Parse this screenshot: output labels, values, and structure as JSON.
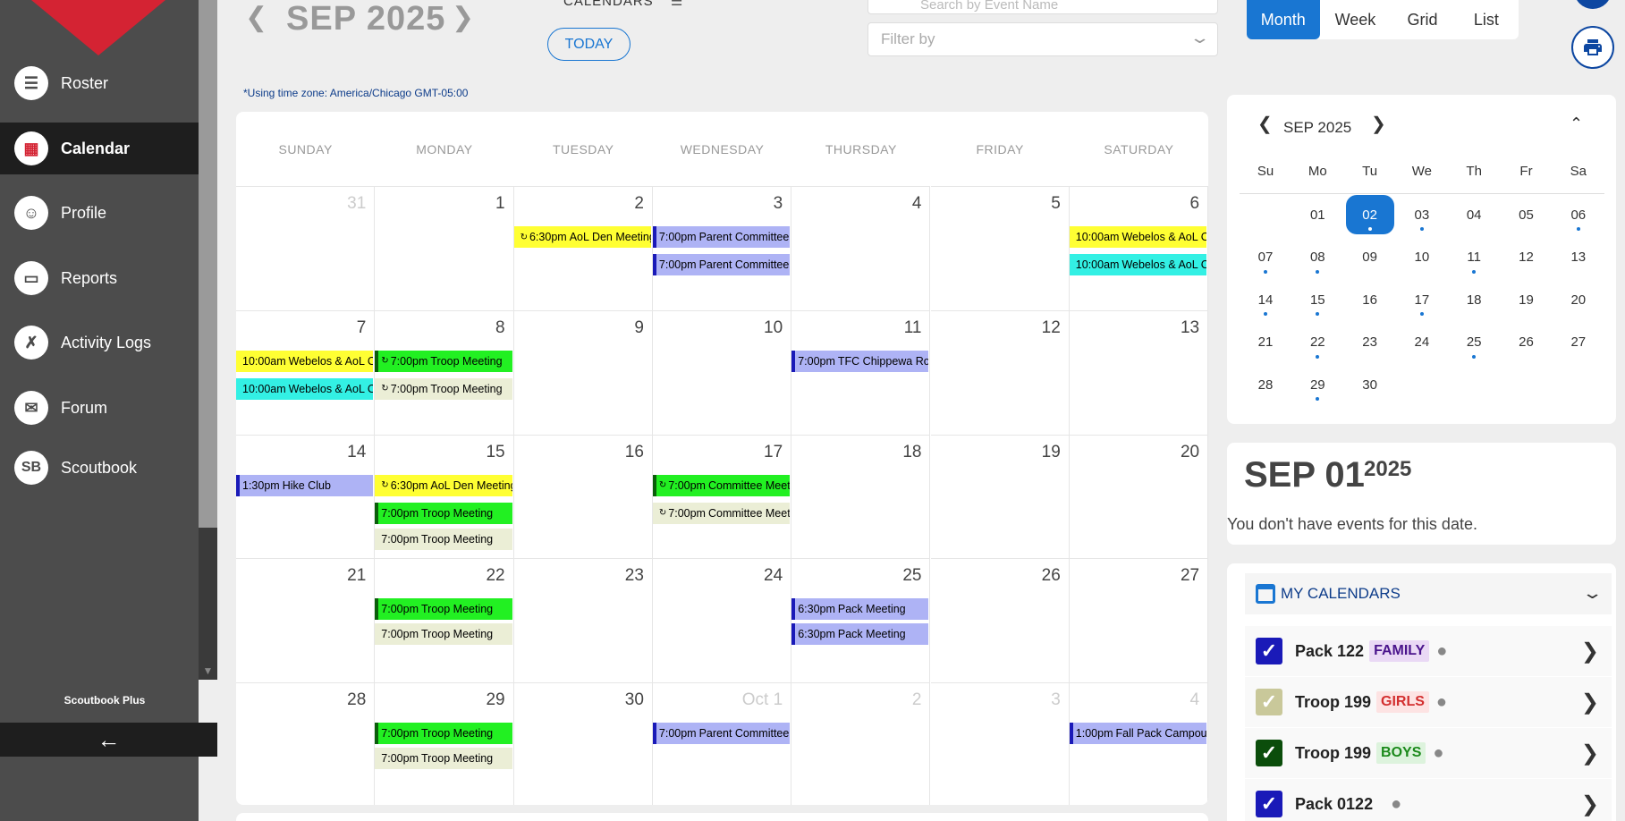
{
  "sidebar": {
    "items": [
      {
        "label": "Roster",
        "icon": "list-icon",
        "glyph": "☰"
      },
      {
        "label": "Calendar",
        "icon": "calendar-icon",
        "glyph": "▦"
      },
      {
        "label": "Profile",
        "icon": "face-icon",
        "glyph": "☺"
      },
      {
        "label": "Reports",
        "icon": "clipboard-icon",
        "glyph": "▭"
      },
      {
        "label": "Activity Logs",
        "icon": "activity-icon",
        "glyph": "✗"
      },
      {
        "label": "Forum",
        "icon": "forum-icon",
        "glyph": "✉"
      },
      {
        "label": "Scoutbook",
        "icon": "scoutbook-icon",
        "glyph": "SB"
      }
    ],
    "active_index": 1,
    "plus_label": "Scoutbook Plus",
    "collapse_glyph": "←"
  },
  "header": {
    "title": "SEP 2025",
    "calendars_label": "CALENDARS",
    "today_label": "TODAY",
    "search_placeholder": "Search by Event Name",
    "filter_placeholder": "Filter by",
    "views": [
      "Month",
      "Week",
      "Grid",
      "List"
    ],
    "selected_view": "Month",
    "timezone_note": "*Using time zone: America/Chicago GMT-05:00"
  },
  "calendar": {
    "weekdays": [
      "SUNDAY",
      "MONDAY",
      "TUESDAY",
      "WEDNESDAY",
      "THURSDAY",
      "FRIDAY",
      "SATURDAY"
    ],
    "weeks": [
      [
        {
          "day": "31",
          "other": true
        },
        {
          "day": "1"
        },
        {
          "day": "2"
        },
        {
          "day": "3"
        },
        {
          "day": "4"
        },
        {
          "day": "5"
        },
        {
          "day": "6"
        }
      ],
      [
        {
          "day": "7"
        },
        {
          "day": "8"
        },
        {
          "day": "9"
        },
        {
          "day": "10"
        },
        {
          "day": "11"
        },
        {
          "day": "12"
        },
        {
          "day": "13"
        }
      ],
      [
        {
          "day": "14"
        },
        {
          "day": "15"
        },
        {
          "day": "16"
        },
        {
          "day": "17"
        },
        {
          "day": "18"
        },
        {
          "day": "19"
        },
        {
          "day": "20"
        }
      ],
      [
        {
          "day": "21"
        },
        {
          "day": "22"
        },
        {
          "day": "23"
        },
        {
          "day": "24"
        },
        {
          "day": "25"
        },
        {
          "day": "26"
        },
        {
          "day": "27"
        }
      ],
      [
        {
          "day": "28"
        },
        {
          "day": "29"
        },
        {
          "day": "30"
        },
        {
          "day": "Oct 1",
          "other": true
        },
        {
          "day": "2",
          "other": true
        },
        {
          "day": "3",
          "other": true
        },
        {
          "day": "4",
          "other": true
        }
      ]
    ],
    "events": [
      {
        "week": 0,
        "col": 2,
        "slot": 0,
        "time": "6:30pm",
        "title": "AoL Den Meeting",
        "recurring": true,
        "bg": "#ffff33",
        "bar": "#ffff33"
      },
      {
        "week": 0,
        "col": 3,
        "slot": 0,
        "time": "7:00pm",
        "title": "Parent Committee",
        "recurring": false,
        "bg": "#aeb3f5",
        "bar": "#1a1ab8"
      },
      {
        "week": 0,
        "col": 3,
        "slot": 1,
        "time": "7:00pm",
        "title": "Parent Committee",
        "recurring": false,
        "bg": "#aeb3f5",
        "bar": "#1a1ab8"
      },
      {
        "week": 0,
        "col": 6,
        "slot": 0,
        "time": "10:00am",
        "title": "Webelos & AoL Camp",
        "recurring": false,
        "bg": "#ffff33",
        "bar": "#ffff33"
      },
      {
        "week": 0,
        "col": 6,
        "slot": 1,
        "time": "10:00am",
        "title": "Webelos & AoL Camp",
        "recurring": false,
        "bg": "#33f0e4",
        "bar": "#33f0e4"
      },
      {
        "week": 1,
        "col": 0,
        "slot": 0,
        "time": "10:00am",
        "title": "Webelos & AoL Camp",
        "recurring": false,
        "bg": "#ffff33",
        "bar": "#ffff33"
      },
      {
        "week": 1,
        "col": 0,
        "slot": 1,
        "time": "10:00am",
        "title": "Webelos & AoL Camp",
        "recurring": false,
        "bg": "#33f0e4",
        "bar": "#33f0e4"
      },
      {
        "week": 1,
        "col": 1,
        "slot": 0,
        "time": "7:00pm",
        "title": "Troop Meeting",
        "recurring": true,
        "bg": "#22f022",
        "bar": "#0b5e0b"
      },
      {
        "week": 1,
        "col": 1,
        "slot": 1,
        "time": "7:00pm",
        "title": "Troop Meeting",
        "recurring": true,
        "bg": "#ebeed6",
        "bar": "#ebeed6"
      },
      {
        "week": 1,
        "col": 4,
        "slot": 0,
        "time": "7:00pm",
        "title": "TFC Chippewa Round",
        "recurring": false,
        "bg": "#aeb3f5",
        "bar": "#1a1ab8"
      },
      {
        "week": 2,
        "col": 0,
        "slot": 0,
        "time": "1:30pm",
        "title": "Hike Club",
        "recurring": false,
        "bg": "#aeb3f5",
        "bar": "#1a1ab8"
      },
      {
        "week": 2,
        "col": 1,
        "slot": 0,
        "time": "6:30pm",
        "title": "AoL Den Meeting",
        "recurring": true,
        "bg": "#ffff33",
        "bar": "#ffff33"
      },
      {
        "week": 2,
        "col": 1,
        "slot": 1,
        "time": "7:00pm",
        "title": "Troop Meeting",
        "recurring": false,
        "bg": "#22f022",
        "bar": "#0b5e0b"
      },
      {
        "week": 2,
        "col": 1,
        "slot": 2,
        "time": "7:00pm",
        "title": "Troop Meeting",
        "recurring": false,
        "bg": "#ebeed6",
        "bar": "#ebeed6"
      },
      {
        "week": 2,
        "col": 3,
        "slot": 0,
        "time": "7:00pm",
        "title": "Committee Meeting",
        "recurring": true,
        "bg": "#22f022",
        "bar": "#0b5e0b"
      },
      {
        "week": 2,
        "col": 3,
        "slot": 1,
        "time": "7:00pm",
        "title": "Committee Meeting",
        "recurring": true,
        "bg": "#ebeed6",
        "bar": "#ebeed6"
      },
      {
        "week": 3,
        "col": 1,
        "slot": 0,
        "time": "7:00pm",
        "title": "Troop Meeting",
        "recurring": false,
        "bg": "#22f022",
        "bar": "#0b5e0b"
      },
      {
        "week": 3,
        "col": 1,
        "slot": 1,
        "time": "7:00pm",
        "title": "Troop Meeting",
        "recurring": false,
        "bg": "#ebeed6",
        "bar": "#ebeed6"
      },
      {
        "week": 3,
        "col": 4,
        "slot": 0,
        "time": "6:30pm",
        "title": "Pack Meeting",
        "recurring": false,
        "bg": "#aeb3f5",
        "bar": "#1a1ab8"
      },
      {
        "week": 3,
        "col": 4,
        "slot": 1,
        "time": "6:30pm",
        "title": "Pack Meeting",
        "recurring": false,
        "bg": "#aeb3f5",
        "bar": "#1a1ab8"
      },
      {
        "week": 4,
        "col": 1,
        "slot": 0,
        "time": "7:00pm",
        "title": "Troop Meeting",
        "recurring": false,
        "bg": "#22f022",
        "bar": "#0b5e0b"
      },
      {
        "week": 4,
        "col": 1,
        "slot": 1,
        "time": "7:00pm",
        "title": "Troop Meeting",
        "recurring": false,
        "bg": "#ebeed6",
        "bar": "#ebeed6"
      },
      {
        "week": 4,
        "col": 3,
        "slot": 0,
        "time": "7:00pm",
        "title": "Parent Committee",
        "recurring": false,
        "bg": "#aeb3f5",
        "bar": "#1a1ab8"
      },
      {
        "week": 4,
        "col": 6,
        "slot": 0,
        "time": "1:00pm",
        "title": "Fall Pack Campout",
        "recurring": false,
        "bg": "#aeb3f5",
        "bar": "#1a1ab8"
      }
    ]
  },
  "mini_calendar": {
    "title": "SEP 2025",
    "weekdays": [
      "Su",
      "Mo",
      "Tu",
      "We",
      "Th",
      "Fr",
      "Sa"
    ],
    "lead_blanks": 1,
    "days": [
      {
        "d": "01",
        "dot": false
      },
      {
        "d": "02",
        "dot": true,
        "selected": true
      },
      {
        "d": "03",
        "dot": true
      },
      {
        "d": "04",
        "dot": false
      },
      {
        "d": "05",
        "dot": false
      },
      {
        "d": "06",
        "dot": true
      },
      {
        "d": "07",
        "dot": true
      },
      {
        "d": "08",
        "dot": true
      },
      {
        "d": "09",
        "dot": false
      },
      {
        "d": "10",
        "dot": false
      },
      {
        "d": "11",
        "dot": true
      },
      {
        "d": "12",
        "dot": false
      },
      {
        "d": "13",
        "dot": false
      },
      {
        "d": "14",
        "dot": true
      },
      {
        "d": "15",
        "dot": true
      },
      {
        "d": "16",
        "dot": false
      },
      {
        "d": "17",
        "dot": true
      },
      {
        "d": "18",
        "dot": false
      },
      {
        "d": "19",
        "dot": false
      },
      {
        "d": "20",
        "dot": false
      },
      {
        "d": "21",
        "dot": false
      },
      {
        "d": "22",
        "dot": true
      },
      {
        "d": "23",
        "dot": false
      },
      {
        "d": "24",
        "dot": false
      },
      {
        "d": "25",
        "dot": true
      },
      {
        "d": "26",
        "dot": false
      },
      {
        "d": "27",
        "dot": false
      },
      {
        "d": "28",
        "dot": false
      },
      {
        "d": "29",
        "dot": true
      },
      {
        "d": "30",
        "dot": false
      }
    ]
  },
  "selected_date": {
    "date": "SEP 01",
    "year": "2025",
    "message": "You don't have events for this date."
  },
  "my_calendars": {
    "title": "MY CALENDARS",
    "items": [
      {
        "name": "Pack 122",
        "tag": "FAMILY",
        "tag_color": "#4a148c",
        "tag_bg": "#ead9f5",
        "check_bg": "#1a1ab8",
        "check": "✓"
      },
      {
        "name": "Troop 199",
        "tag": "GIRLS",
        "tag_color": "#d32f2f",
        "tag_bg": "#fde3e3",
        "check_bg": "#c9c89a",
        "check": "✓"
      },
      {
        "name": "Troop 199",
        "tag": "BOYS",
        "tag_color": "#1b8a1b",
        "tag_bg": "#ddf3dd",
        "check_bg": "#0b4d0b",
        "check": "✓"
      },
      {
        "name": "Pack 0122",
        "tag": "",
        "tag_color": "#000",
        "tag_bg": "transparent",
        "check_bg": "#1a1ab8",
        "check": "✓"
      }
    ]
  }
}
